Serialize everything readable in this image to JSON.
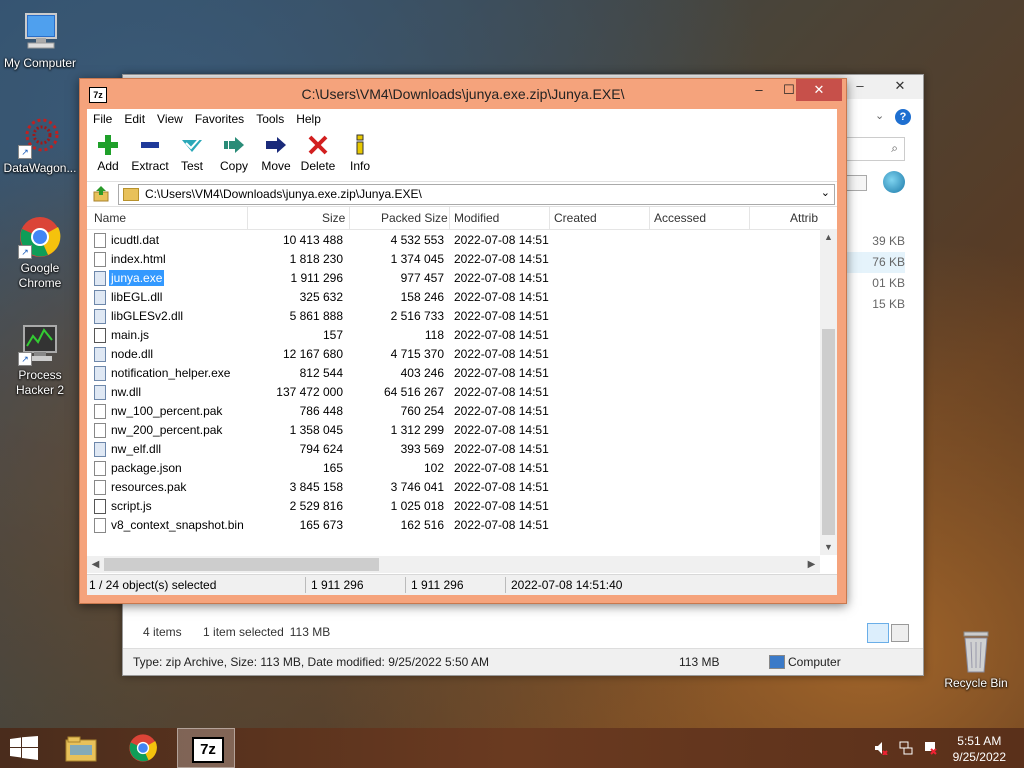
{
  "desktop": {
    "icons": [
      {
        "label": "My Computer"
      },
      {
        "label": "DataWagon..."
      },
      {
        "label": "Google Chrome"
      },
      {
        "label": "Process Hacker 2"
      },
      {
        "label": "Recycle Bin"
      }
    ]
  },
  "explorer": {
    "sizes": [
      "39 KB",
      "76 KB",
      "01 KB",
      "15 KB"
    ],
    "items_count": "4 items",
    "selected_info": "1 item selected",
    "selected_size": "113 MB",
    "details": "Type: zip Archive, Size: 113 MB, Date modified: 9/25/2022 5:50 AM",
    "size_right": "113 MB",
    "location": "Computer"
  },
  "sevenzip": {
    "title": "C:\\Users\\VM4\\Downloads\\junya.exe.zip\\Junya.EXE\\",
    "app_icon": "7z",
    "menu": [
      "File",
      "Edit",
      "View",
      "Favorites",
      "Tools",
      "Help"
    ],
    "toolbar": [
      {
        "label": "Add",
        "icon": "plus-icon",
        "color": "#1fa02a"
      },
      {
        "label": "Extract",
        "icon": "minus-icon",
        "color": "#1f3a9a"
      },
      {
        "label": "Test",
        "icon": "check-icon",
        "color": "#2aa8b8"
      },
      {
        "label": "Copy",
        "icon": "copy-arrow-icon",
        "color": "#2a8c78"
      },
      {
        "label": "Move",
        "icon": "move-arrow-icon",
        "color": "#1a2a7a"
      },
      {
        "label": "Delete",
        "icon": "x-icon",
        "color": "#d21f1f"
      },
      {
        "label": "Info",
        "icon": "info-icon",
        "color": "#e8c800"
      }
    ],
    "address": "C:\\Users\\VM4\\Downloads\\junya.exe.zip\\Junya.EXE\\",
    "columns": [
      "Name",
      "Size",
      "Packed Size",
      "Modified",
      "Created",
      "Accessed",
      "Attrib"
    ],
    "files": [
      {
        "name": "icudtl.dat",
        "size": "10 413 488",
        "packed": "4 532 553",
        "modified": "2022-07-08 14:51",
        "type": "file"
      },
      {
        "name": "index.html",
        "size": "1 818 230",
        "packed": "1 374 045",
        "modified": "2022-07-08 14:51",
        "type": "file"
      },
      {
        "name": "junya.exe",
        "size": "1 911 296",
        "packed": "977 457",
        "modified": "2022-07-08 14:51",
        "type": "exe",
        "selected": true
      },
      {
        "name": "libEGL.dll",
        "size": "325 632",
        "packed": "158 246",
        "modified": "2022-07-08 14:51",
        "type": "dll"
      },
      {
        "name": "libGLESv2.dll",
        "size": "5 861 888",
        "packed": "2 516 733",
        "modified": "2022-07-08 14:51",
        "type": "dll"
      },
      {
        "name": "main.js",
        "size": "157",
        "packed": "118",
        "modified": "2022-07-08 14:51",
        "type": "js"
      },
      {
        "name": "node.dll",
        "size": "12 167 680",
        "packed": "4 715 370",
        "modified": "2022-07-08 14:51",
        "type": "dll"
      },
      {
        "name": "notification_helper.exe",
        "size": "812 544",
        "packed": "403 246",
        "modified": "2022-07-08 14:51",
        "type": "exe"
      },
      {
        "name": "nw.dll",
        "size": "137 472 000",
        "packed": "64 516 267",
        "modified": "2022-07-08 14:51",
        "type": "dll"
      },
      {
        "name": "nw_100_percent.pak",
        "size": "786 448",
        "packed": "760 254",
        "modified": "2022-07-08 14:51",
        "type": "file"
      },
      {
        "name": "nw_200_percent.pak",
        "size": "1 358 045",
        "packed": "1 312 299",
        "modified": "2022-07-08 14:51",
        "type": "file"
      },
      {
        "name": "nw_elf.dll",
        "size": "794 624",
        "packed": "393 569",
        "modified": "2022-07-08 14:51",
        "type": "dll"
      },
      {
        "name": "package.json",
        "size": "165",
        "packed": "102",
        "modified": "2022-07-08 14:51",
        "type": "file"
      },
      {
        "name": "resources.pak",
        "size": "3 845 158",
        "packed": "3 746 041",
        "modified": "2022-07-08 14:51",
        "type": "file"
      },
      {
        "name": "script.js",
        "size": "2 529 816",
        "packed": "1 025 018",
        "modified": "2022-07-08 14:51",
        "type": "js"
      },
      {
        "name": "v8_context_snapshot.bin",
        "size": "165 673",
        "packed": "162 516",
        "modified": "2022-07-08 14:51",
        "type": "file"
      }
    ],
    "status": {
      "selection": "1 / 24 object(s) selected",
      "size": "1 911 296",
      "packed": "1 911 296",
      "modified": "2022-07-08 14:51:40"
    }
  },
  "taskbar": {
    "time": "5:51 AM",
    "date": "9/25/2022",
    "sevenzip_label": "7z"
  }
}
